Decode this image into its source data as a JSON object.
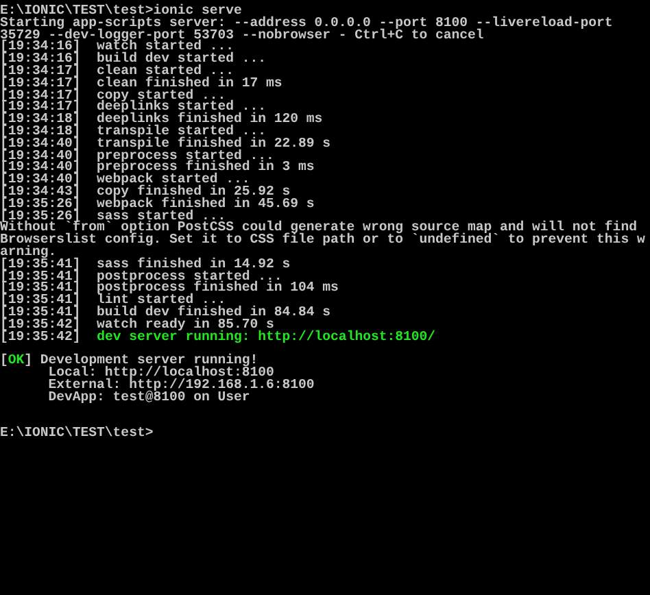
{
  "terminal": {
    "lines": [
      {
        "kind": "text",
        "segments": [
          {
            "text": "E:\\IONIC\\TEST\\test>ionic serve",
            "color": "#c8c8c8"
          }
        ]
      },
      {
        "kind": "text",
        "segments": [
          {
            "text": "Starting app-scripts server: --address 0.0.0.0 --port 8100 --livereload-port",
            "color": "#c8c8c8"
          }
        ]
      },
      {
        "kind": "text",
        "segments": [
          {
            "text": "35729 --dev-logger-port 53703 --nobrowser - Ctrl+C to cancel",
            "color": "#c8c8c8"
          }
        ]
      },
      {
        "kind": "text",
        "segments": [
          {
            "text": "[19:34:16]  watch started ...",
            "color": "#c8c8c8"
          }
        ]
      },
      {
        "kind": "text",
        "segments": [
          {
            "text": "[19:34:16]  build dev started ...",
            "color": "#c8c8c8"
          }
        ]
      },
      {
        "kind": "text",
        "segments": [
          {
            "text": "[19:34:17]  clean started ...",
            "color": "#c8c8c8"
          }
        ]
      },
      {
        "kind": "text",
        "segments": [
          {
            "text": "[19:34:17]  clean finished in 17 ms",
            "color": "#c8c8c8"
          }
        ]
      },
      {
        "kind": "text",
        "segments": [
          {
            "text": "[19:34:17]  copy started ...",
            "color": "#c8c8c8"
          }
        ]
      },
      {
        "kind": "text",
        "segments": [
          {
            "text": "[19:34:17]  deeplinks started ...",
            "color": "#c8c8c8"
          }
        ]
      },
      {
        "kind": "text",
        "segments": [
          {
            "text": "[19:34:18]  deeplinks finished in 120 ms",
            "color": "#c8c8c8"
          }
        ]
      },
      {
        "kind": "text",
        "segments": [
          {
            "text": "[19:34:18]  transpile started ...",
            "color": "#c8c8c8"
          }
        ]
      },
      {
        "kind": "text",
        "segments": [
          {
            "text": "[19:34:40]  transpile finished in 22.89 s",
            "color": "#c8c8c8"
          }
        ]
      },
      {
        "kind": "text",
        "segments": [
          {
            "text": "[19:34:40]  preprocess started ...",
            "color": "#c8c8c8"
          }
        ]
      },
      {
        "kind": "text",
        "segments": [
          {
            "text": "[19:34:40]  preprocess finished in 3 ms",
            "color": "#c8c8c8"
          }
        ]
      },
      {
        "kind": "text",
        "segments": [
          {
            "text": "[19:34:40]  webpack started ...",
            "color": "#c8c8c8"
          }
        ]
      },
      {
        "kind": "text",
        "segments": [
          {
            "text": "[19:34:43]  copy finished in 25.92 s",
            "color": "#c8c8c8"
          }
        ]
      },
      {
        "kind": "text",
        "segments": [
          {
            "text": "[19:35:26]  webpack finished in 45.69 s",
            "color": "#c8c8c8"
          }
        ]
      },
      {
        "kind": "text",
        "segments": [
          {
            "text": "[19:35:26]  sass started ...",
            "color": "#c8c8c8"
          }
        ]
      },
      {
        "kind": "text",
        "segments": [
          {
            "text": "Without `from` option PostCSS could generate wrong source map and will not find",
            "color": "#c8c8c8"
          }
        ]
      },
      {
        "kind": "text",
        "segments": [
          {
            "text": "Browserslist config. Set it to CSS file path or to `undefined` to prevent this w",
            "color": "#c8c8c8"
          }
        ]
      },
      {
        "kind": "text",
        "segments": [
          {
            "text": "arning.",
            "color": "#c8c8c8"
          }
        ]
      },
      {
        "kind": "text",
        "segments": [
          {
            "text": "[19:35:41]  sass finished in 14.92 s",
            "color": "#c8c8c8"
          }
        ]
      },
      {
        "kind": "text",
        "segments": [
          {
            "text": "[19:35:41]  postprocess started ...",
            "color": "#c8c8c8"
          }
        ]
      },
      {
        "kind": "text",
        "segments": [
          {
            "text": "[19:35:41]  postprocess finished in 104 ms",
            "color": "#c8c8c8"
          }
        ]
      },
      {
        "kind": "text",
        "segments": [
          {
            "text": "[19:35:41]  lint started ...",
            "color": "#c8c8c8"
          }
        ]
      },
      {
        "kind": "text",
        "segments": [
          {
            "text": "[19:35:41]  build dev finished in 84.84 s",
            "color": "#c8c8c8"
          }
        ]
      },
      {
        "kind": "text",
        "segments": [
          {
            "text": "[19:35:42]  watch ready in 85.70 s",
            "color": "#c8c8c8"
          }
        ]
      },
      {
        "kind": "text",
        "segments": [
          {
            "text": "[19:35:42]  ",
            "color": "#c8c8c8"
          },
          {
            "text": "dev server running: http://localhost:8100/",
            "color": "#22e622"
          }
        ]
      },
      {
        "kind": "blank"
      },
      {
        "kind": "text",
        "segments": [
          {
            "text": "[",
            "color": "#c8c8c8"
          },
          {
            "text": "OK",
            "color": "#22e622"
          },
          {
            "text": "] Development server running!",
            "color": "#c8c8c8"
          }
        ]
      },
      {
        "kind": "text",
        "segments": [
          {
            "text": "      Local: http://localhost:8100",
            "color": "#c8c8c8"
          }
        ]
      },
      {
        "kind": "text",
        "segments": [
          {
            "text": "      External: http://192.168.1.6:8100",
            "color": "#c8c8c8"
          }
        ]
      },
      {
        "kind": "text",
        "segments": [
          {
            "text": "      DevApp: test@8100 on User",
            "color": "#c8c8c8"
          }
        ]
      },
      {
        "kind": "blank"
      },
      {
        "kind": "blank"
      },
      {
        "kind": "text",
        "segments": [
          {
            "text": "E:\\IONIC\\TEST\\test>",
            "color": "#c8c8c8"
          }
        ]
      }
    ]
  }
}
